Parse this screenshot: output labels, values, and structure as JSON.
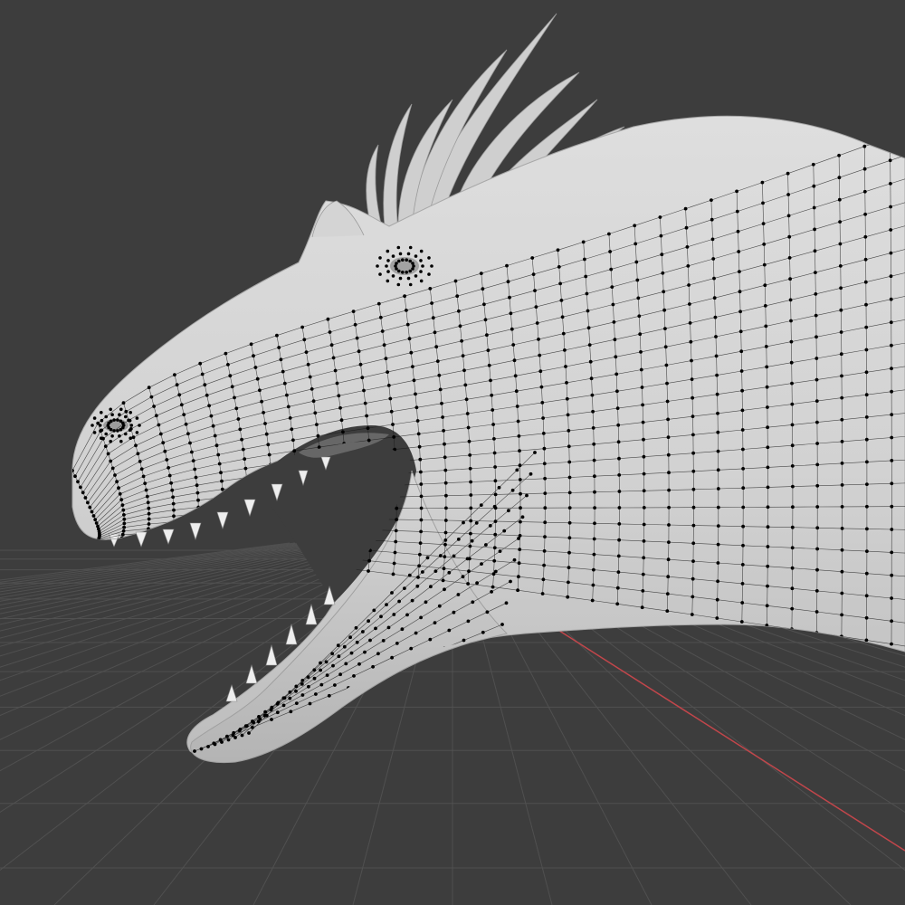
{
  "viewport": {
    "background": "#3d3d3d",
    "grid_color": "#505050",
    "x_axis_color": "#c2464b"
  },
  "model": {
    "icon": "dinosaur-head-mesh-icon",
    "surface_color": "#d9d9d9",
    "shade_color": "#b8b8b8",
    "wire_color": "#1a1a1a",
    "vertex_color": "#000000"
  }
}
